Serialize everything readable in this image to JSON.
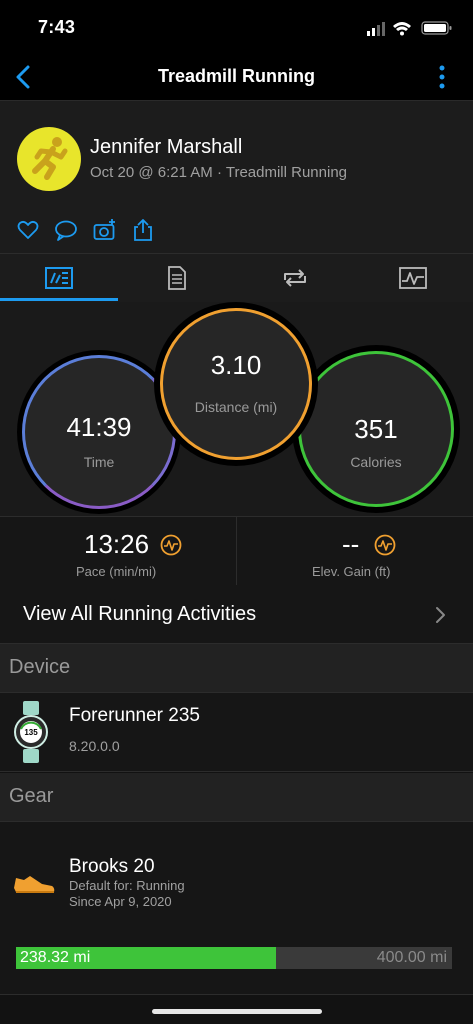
{
  "status_bar": {
    "time": "7:43"
  },
  "nav": {
    "title": "Treadmill Running"
  },
  "header": {
    "name": "Jennifer Marshall",
    "subtitle": "Oct 20 @ 6:21 AM · Treadmill Running"
  },
  "actions": [
    "heart-icon",
    "comment-icon",
    "camera-icon",
    "share-icon"
  ],
  "tabs": [
    "summary-tab",
    "details-tab",
    "laps-tab",
    "charts-tab"
  ],
  "stats": {
    "time": {
      "value": "41:39",
      "label": "Time"
    },
    "distance": {
      "value": "3.10",
      "label": "Distance (mi)"
    },
    "calories": {
      "value": "351",
      "label": "Calories"
    }
  },
  "metrics": {
    "pace": {
      "value": "13:26",
      "label": "Pace (min/mi)"
    },
    "elev": {
      "value": "--",
      "label": "Elev. Gain (ft)"
    }
  },
  "view_all": {
    "label": "View All Running Activities"
  },
  "device": {
    "section_label": "Device",
    "name": "Forerunner 235",
    "version": "8.20.0.0",
    "watch_face_text": "135"
  },
  "gear": {
    "section_label": "Gear",
    "name": "Brooks 20",
    "default_for": "Default for: Running",
    "since": "Since Apr 9, 2020",
    "distance_used": "238.32 mi",
    "distance_max": "400.00 mi",
    "progress_fraction": 0.5958
  },
  "colors": {
    "accent": "#1d9bf0",
    "time_ring": "#5b7ed8",
    "distance_ring": "#f0a030",
    "calories_ring": "#3ec43a",
    "warning": "#f0a030"
  }
}
